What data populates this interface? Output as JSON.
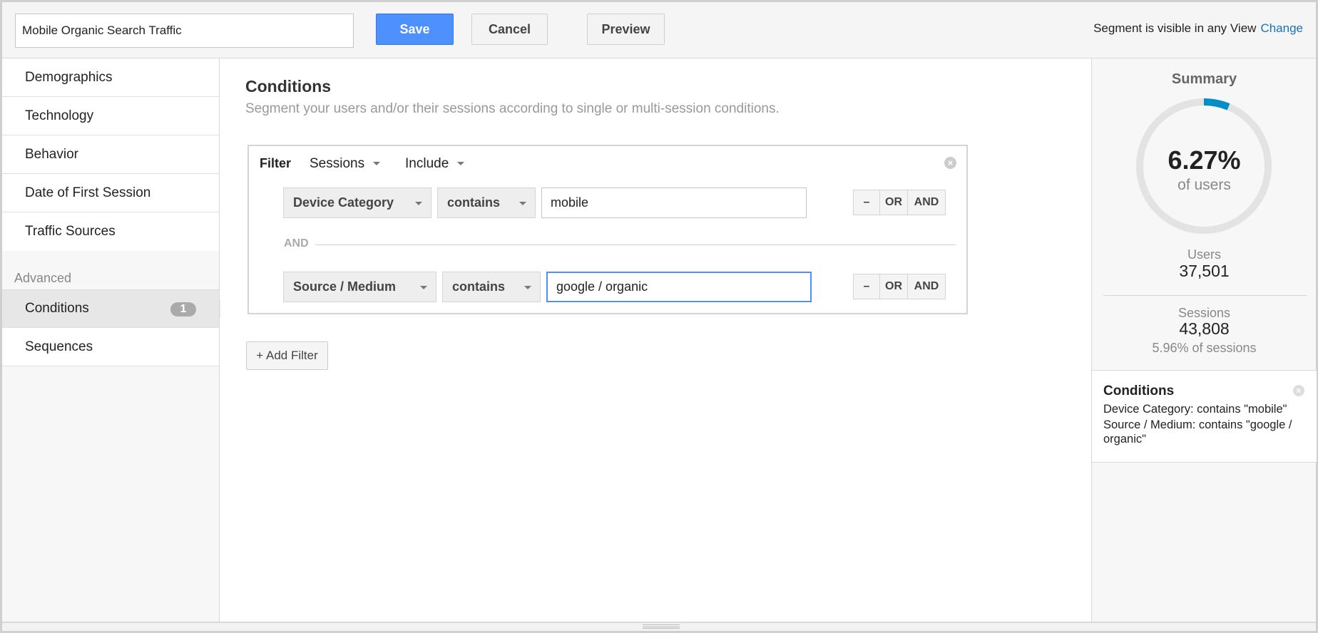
{
  "topbar": {
    "segment_name": "Mobile Organic Search Traffic",
    "save_label": "Save",
    "cancel_label": "Cancel",
    "preview_label": "Preview",
    "visibility_text": "Segment is visible in any View",
    "change_label": "Change",
    "accent_color": "#4d90fe"
  },
  "sidebar": {
    "items": [
      {
        "label": "Demographics"
      },
      {
        "label": "Technology"
      },
      {
        "label": "Behavior"
      },
      {
        "label": "Date of First Session"
      },
      {
        "label": "Traffic Sources"
      }
    ],
    "advanced_heading": "Advanced",
    "advanced_items": [
      {
        "label": "Conditions",
        "badge": "1",
        "active": true
      },
      {
        "label": "Sequences"
      }
    ]
  },
  "main": {
    "title": "Conditions",
    "subtitle": "Segment your users and/or their sessions according to single or multi-session conditions.",
    "filter": {
      "label": "Filter",
      "scope": "Sessions",
      "mode": "Include",
      "rows": [
        {
          "dimension": "Device Category",
          "operator": "contains",
          "value": "mobile"
        },
        {
          "dimension": "Source / Medium",
          "operator": "contains",
          "value": "google / organic"
        }
      ],
      "separator": "AND",
      "minus_label": "–",
      "or_label": "OR",
      "and_label": "AND"
    },
    "add_filter_label": "+ Add Filter"
  },
  "summary": {
    "title": "Summary",
    "percent": "6.27%",
    "percent_value": 0.0627,
    "percent_sub": "of users",
    "users_label": "Users",
    "users_value": "37,501",
    "sessions_label": "Sessions",
    "sessions_value": "43,808",
    "sessions_pct": "5.96% of sessions",
    "gauge_color": "#058dc7",
    "conditions_title": "Conditions",
    "conditions_lines": [
      "Device Category: contains \"mobile\"",
      "Source / Medium: contains \"google / organic\""
    ]
  }
}
